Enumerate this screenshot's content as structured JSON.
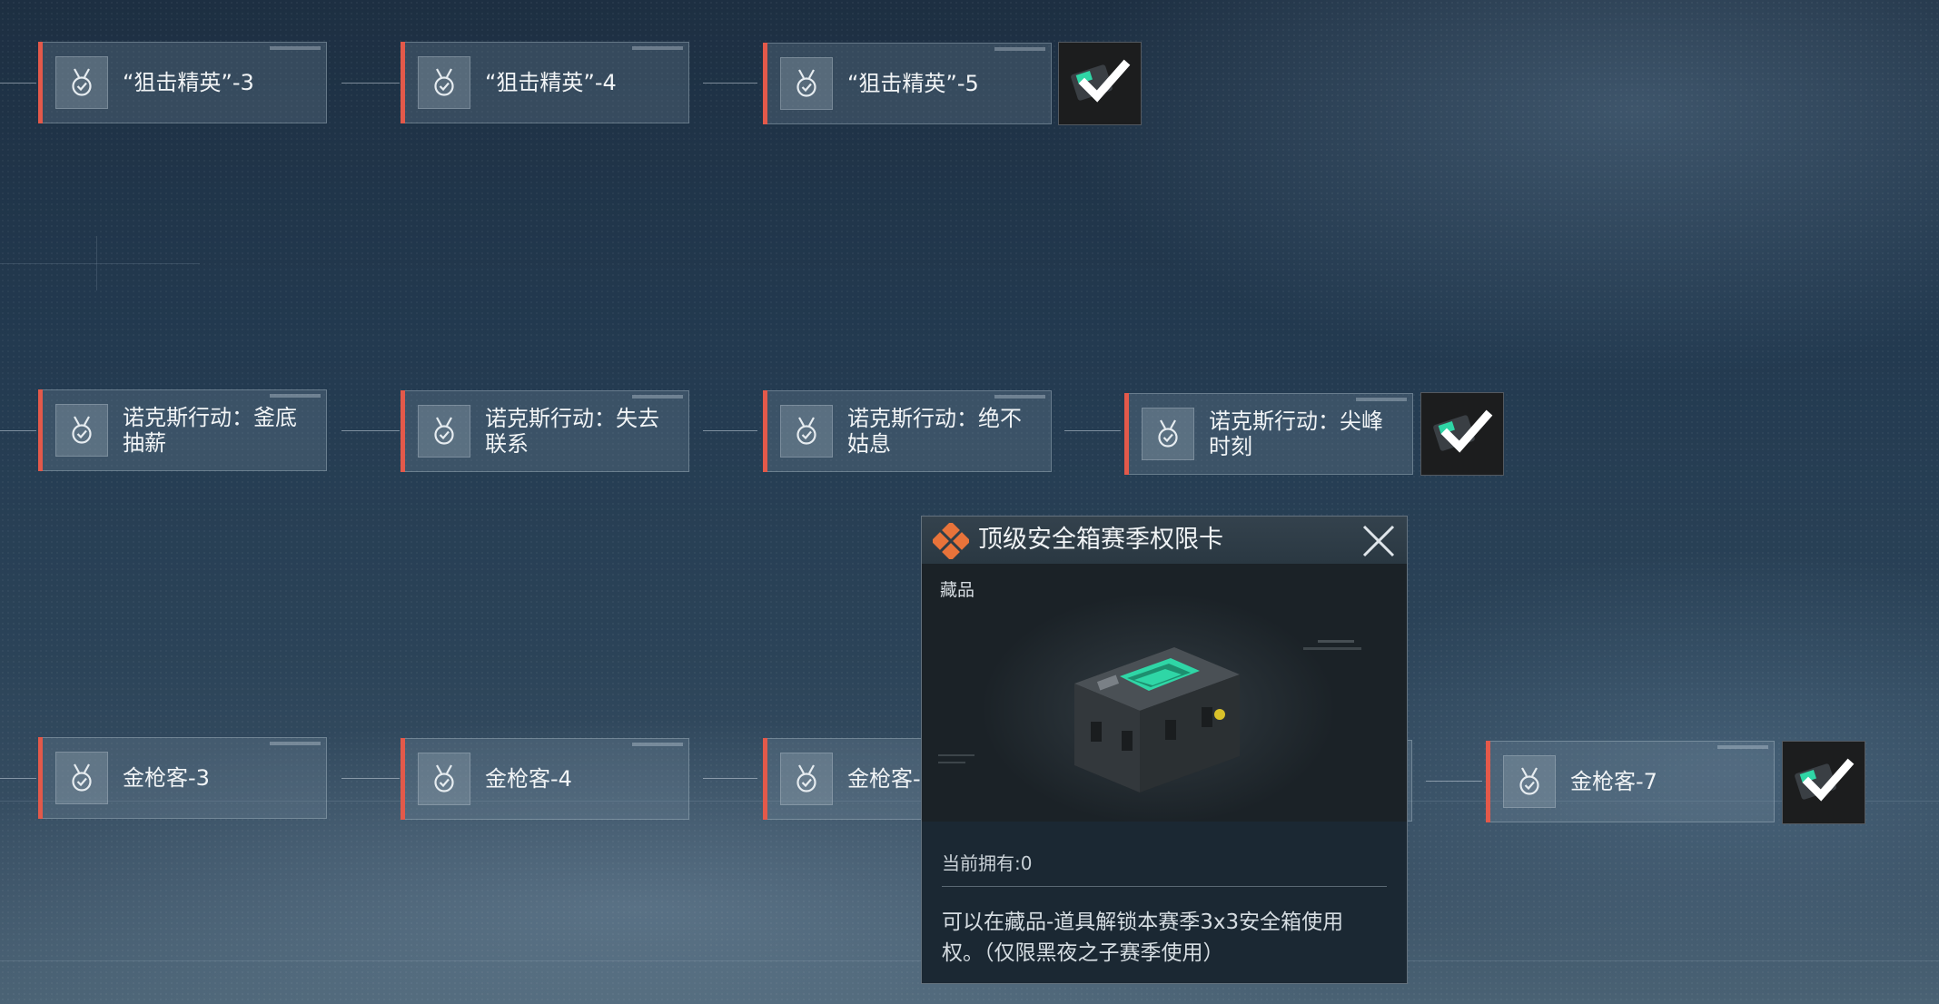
{
  "rows": [
    {
      "cards": [
        {
          "label": "“狙击精英”-3"
        },
        {
          "label": "“狙击精英”-4"
        },
        {
          "label": "“狙击精英”-5"
        }
      ]
    },
    {
      "cards": [
        {
          "label": "诺克斯行动：釜底抽薪"
        },
        {
          "label": "诺克斯行动：失去联系"
        },
        {
          "label": "诺克斯行动：绝不姑息"
        },
        {
          "label": "诺克斯行动：尖峰时刻"
        }
      ]
    },
    {
      "cards": [
        {
          "label": "金枪客-3"
        },
        {
          "label": "金枪客-4"
        },
        {
          "label": "金枪客-"
        },
        {
          "label": "金枪客-7"
        }
      ]
    }
  ],
  "popup": {
    "title": "顶级安全箱赛季权限卡",
    "category": "藏品",
    "owned_text": "当前拥有:0",
    "description": "可以在藏品-道具解锁本赛季3x3安全箱使用权。（仅限黑夜之子赛季使用）"
  },
  "colors": {
    "accent_red": "#e3594a",
    "logo_orange": "#e8733a",
    "case_green": "#2fd6a6"
  },
  "icons": {
    "card_icon": "medal-check-icon",
    "reward_icon": "reward-case-checkmark-icon",
    "popup_logo": "diamond-logo-icon",
    "close": "close-icon"
  }
}
